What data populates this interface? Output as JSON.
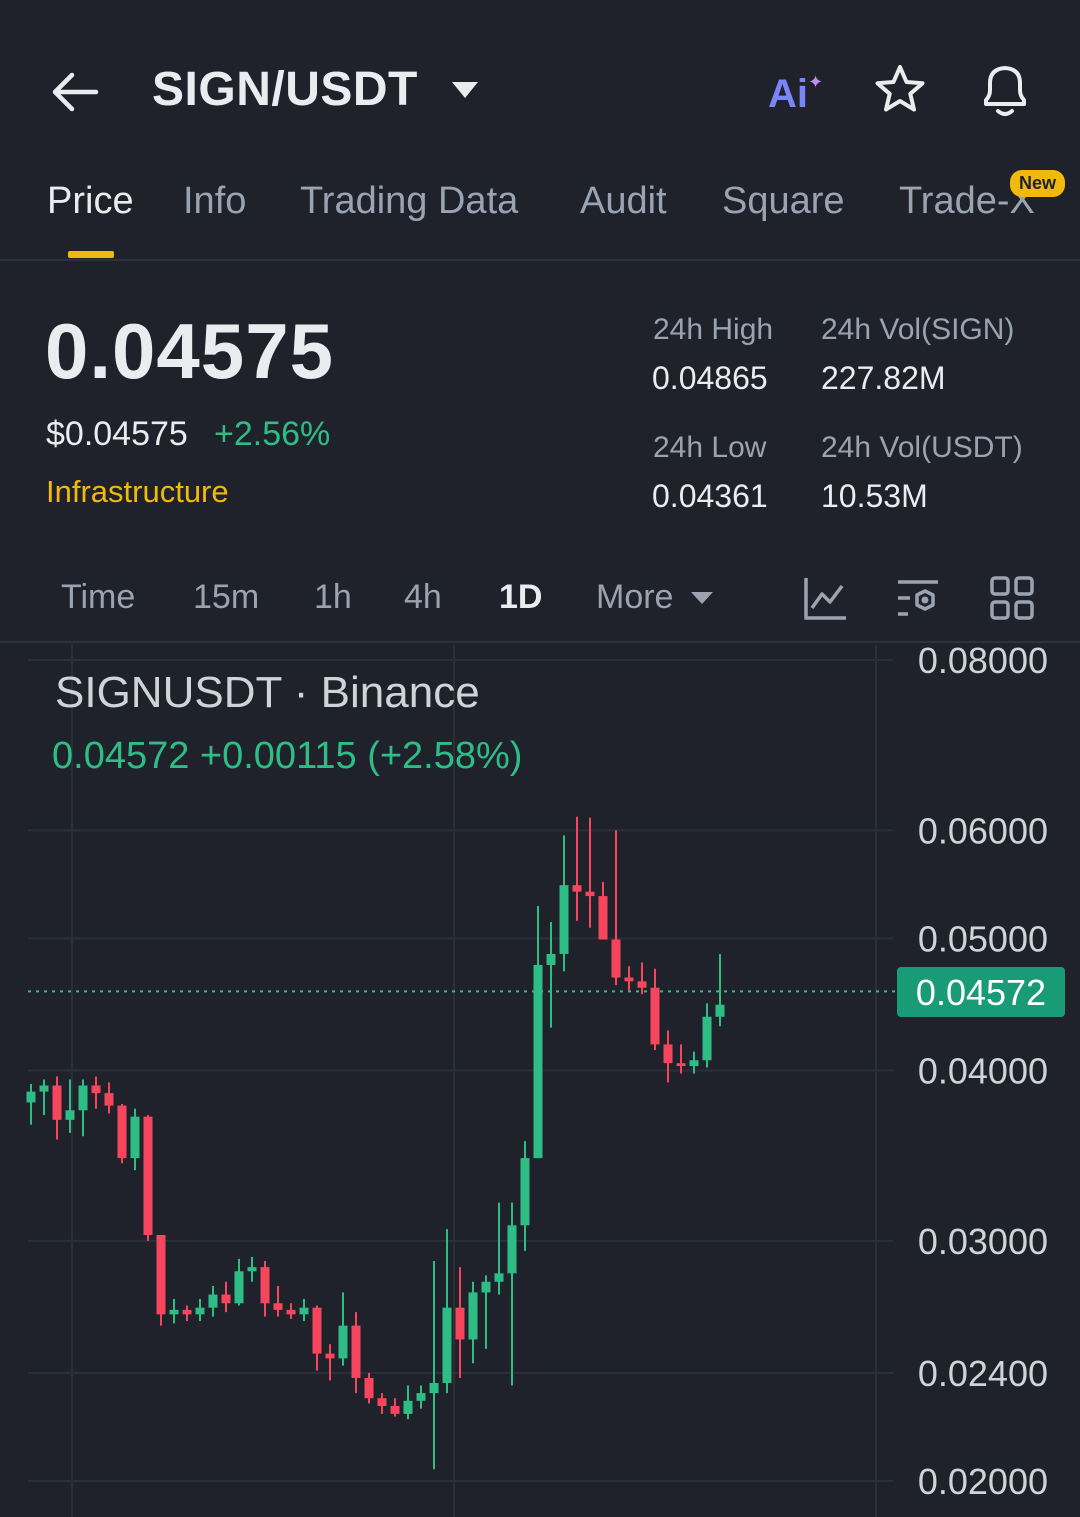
{
  "header": {
    "pair": "SIGN/USDT",
    "ai_label": "Ai",
    "icons": [
      "back-arrow-icon",
      "dropdown-caret-icon",
      "ai-assistant-icon",
      "star-icon",
      "bell-icon"
    ]
  },
  "tabs": [
    {
      "label": "Price",
      "active": true
    },
    {
      "label": "Info"
    },
    {
      "label": "Trading Data"
    },
    {
      "label": "Audit"
    },
    {
      "label": "Square"
    },
    {
      "label": "Trade-X",
      "badge": "New"
    }
  ],
  "price": {
    "last": "0.04575",
    "usd": "$0.04575",
    "change_pct": "+2.56%",
    "category": "Infrastructure"
  },
  "stats": {
    "high_label": "24h High",
    "high_value": "0.04865",
    "low_label": "24h Low",
    "low_value": "0.04361",
    "vol_base_label": "24h Vol(SIGN)",
    "vol_base_value": "227.82M",
    "vol_quote_label": "24h Vol(USDT)",
    "vol_quote_value": "10.53M"
  },
  "intervals": [
    {
      "label": "Time"
    },
    {
      "label": "15m"
    },
    {
      "label": "1h"
    },
    {
      "label": "4h"
    },
    {
      "label": "1D",
      "active": true
    },
    {
      "label": "More"
    }
  ],
  "colors": {
    "up": "#2ebd85",
    "down": "#f6465d",
    "accent": "#f0b90b",
    "background": "#1f222b"
  },
  "chart_data": {
    "type": "candlestick",
    "title": "SIGNUSDT · Binance",
    "ohlc_summary": "0.04572  +0.00115 (+2.58%)",
    "current_price_label": "0.04572",
    "current_price": 0.04572,
    "y_scale": "log",
    "ylim": [
      0.02,
      0.08
    ],
    "y_ticks": [
      "0.08000",
      "0.06000",
      "0.05000",
      "0.04000",
      "0.03000",
      "0.02400",
      "0.02000"
    ],
    "candles": [
      {
        "o": 0.0379,
        "h": 0.0391,
        "l": 0.0365,
        "c": 0.0386
      },
      {
        "o": 0.0386,
        "h": 0.0394,
        "l": 0.0371,
        "c": 0.039
      },
      {
        "o": 0.039,
        "h": 0.0396,
        "l": 0.0356,
        "c": 0.0368
      },
      {
        "o": 0.0368,
        "h": 0.0394,
        "l": 0.036,
        "c": 0.0374
      },
      {
        "o": 0.0374,
        "h": 0.0394,
        "l": 0.0358,
        "c": 0.039
      },
      {
        "o": 0.039,
        "h": 0.0396,
        "l": 0.0375,
        "c": 0.0385
      },
      {
        "o": 0.0385,
        "h": 0.0392,
        "l": 0.0372,
        "c": 0.0377
      },
      {
        "o": 0.0377,
        "h": 0.0378,
        "l": 0.0342,
        "c": 0.0345
      },
      {
        "o": 0.0345,
        "h": 0.0375,
        "l": 0.0338,
        "c": 0.037
      },
      {
        "o": 0.037,
        "h": 0.0371,
        "l": 0.03,
        "c": 0.0303
      },
      {
        "o": 0.0303,
        "h": 0.0303,
        "l": 0.026,
        "c": 0.0265
      },
      {
        "o": 0.0265,
        "h": 0.0272,
        "l": 0.0261,
        "c": 0.0267
      },
      {
        "o": 0.0267,
        "h": 0.0269,
        "l": 0.0262,
        "c": 0.0265
      },
      {
        "o": 0.0265,
        "h": 0.0272,
        "l": 0.0262,
        "c": 0.0268
      },
      {
        "o": 0.0268,
        "h": 0.0278,
        "l": 0.0264,
        "c": 0.0274
      },
      {
        "o": 0.0274,
        "h": 0.028,
        "l": 0.0266,
        "c": 0.027
      },
      {
        "o": 0.027,
        "h": 0.0291,
        "l": 0.0269,
        "c": 0.0285
      },
      {
        "o": 0.0285,
        "h": 0.0292,
        "l": 0.028,
        "c": 0.0287
      },
      {
        "o": 0.0287,
        "h": 0.029,
        "l": 0.0264,
        "c": 0.027
      },
      {
        "o": 0.027,
        "h": 0.0278,
        "l": 0.0264,
        "c": 0.0267
      },
      {
        "o": 0.0267,
        "h": 0.027,
        "l": 0.0263,
        "c": 0.0265
      },
      {
        "o": 0.0265,
        "h": 0.0272,
        "l": 0.0262,
        "c": 0.0268
      },
      {
        "o": 0.0268,
        "h": 0.0269,
        "l": 0.0241,
        "c": 0.0248
      },
      {
        "o": 0.0248,
        "h": 0.0252,
        "l": 0.0237,
        "c": 0.0246
      },
      {
        "o": 0.0246,
        "h": 0.0275,
        "l": 0.0243,
        "c": 0.026
      },
      {
        "o": 0.026,
        "h": 0.0266,
        "l": 0.0232,
        "c": 0.0238
      },
      {
        "o": 0.0238,
        "h": 0.024,
        "l": 0.0228,
        "c": 0.023
      },
      {
        "o": 0.023,
        "h": 0.0232,
        "l": 0.0224,
        "c": 0.0227
      },
      {
        "o": 0.0227,
        "h": 0.023,
        "l": 0.0223,
        "c": 0.0224
      },
      {
        "o": 0.0224,
        "h": 0.0235,
        "l": 0.0222,
        "c": 0.0229
      },
      {
        "o": 0.0229,
        "h": 0.0235,
        "l": 0.0226,
        "c": 0.0232
      },
      {
        "o": 0.0232,
        "h": 0.029,
        "l": 0.0204,
        "c": 0.0236
      },
      {
        "o": 0.0236,
        "h": 0.0306,
        "l": 0.0232,
        "c": 0.0268
      },
      {
        "o": 0.0268,
        "h": 0.0287,
        "l": 0.0238,
        "c": 0.0254
      },
      {
        "o": 0.0254,
        "h": 0.028,
        "l": 0.0244,
        "c": 0.0275
      },
      {
        "o": 0.0275,
        "h": 0.0283,
        "l": 0.025,
        "c": 0.028
      },
      {
        "o": 0.028,
        "h": 0.032,
        "l": 0.0274,
        "c": 0.0284
      },
      {
        "o": 0.0284,
        "h": 0.032,
        "l": 0.0235,
        "c": 0.0308
      },
      {
        "o": 0.0308,
        "h": 0.0355,
        "l": 0.0295,
        "c": 0.0345
      },
      {
        "o": 0.0345,
        "h": 0.0528,
        "l": 0.0345,
        "c": 0.0478
      },
      {
        "o": 0.0478,
        "h": 0.0514,
        "l": 0.043,
        "c": 0.0487
      },
      {
        "o": 0.0487,
        "h": 0.0595,
        "l": 0.0473,
        "c": 0.0547
      },
      {
        "o": 0.0547,
        "h": 0.0614,
        "l": 0.0515,
        "c": 0.0541
      },
      {
        "o": 0.0541,
        "h": 0.0613,
        "l": 0.0509,
        "c": 0.0537
      },
      {
        "o": 0.0537,
        "h": 0.055,
        "l": 0.05,
        "c": 0.0499
      },
      {
        "o": 0.0499,
        "h": 0.06,
        "l": 0.0462,
        "c": 0.0468
      },
      {
        "o": 0.0468,
        "h": 0.0477,
        "l": 0.0458,
        "c": 0.0465
      },
      {
        "o": 0.0465,
        "h": 0.048,
        "l": 0.0455,
        "c": 0.046
      },
      {
        "o": 0.046,
        "h": 0.0475,
        "l": 0.0414,
        "c": 0.0418
      },
      {
        "o": 0.0418,
        "h": 0.0428,
        "l": 0.0392,
        "c": 0.0405
      },
      {
        "o": 0.0405,
        "h": 0.0418,
        "l": 0.0398,
        "c": 0.0403
      },
      {
        "o": 0.0403,
        "h": 0.0413,
        "l": 0.0398,
        "c": 0.0407
      },
      {
        "o": 0.0407,
        "h": 0.0448,
        "l": 0.0402,
        "c": 0.0438
      },
      {
        "o": 0.0438,
        "h": 0.0487,
        "l": 0.0431,
        "c": 0.0447
      }
    ]
  }
}
